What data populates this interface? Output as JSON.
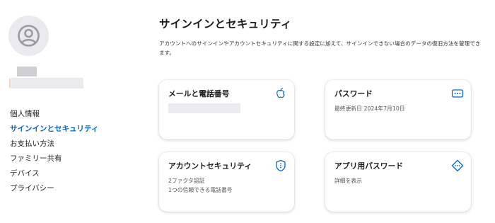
{
  "sidebar": {
    "nav": [
      {
        "label": "個人情報"
      },
      {
        "label": "サインインとセキュリティ"
      },
      {
        "label": "お支払い方法"
      },
      {
        "label": "ファミリー共有"
      },
      {
        "label": "デバイス"
      },
      {
        "label": "プライバシー"
      }
    ],
    "active_index": 1
  },
  "main": {
    "title": "サインインとセキュリティ",
    "description": "アカウントへのサインインやアカウントセキュリティに関する設定に加えて、サインインできない場合のデータの復旧方法を管理できます。",
    "cards": [
      {
        "title": "メールと電話番号",
        "icon": "apple-icon"
      },
      {
        "title": "パスワード",
        "subtitle": "最終更新日 2024年7月10日",
        "icon": "password-dots-icon"
      },
      {
        "title": "アカウントセキュリティ",
        "lines": [
          "2ファクタ認証",
          "1つの信頼できる電話番号"
        ],
        "icon": "shield-icon"
      },
      {
        "title": "アプリ用パスワード",
        "subtitle": "詳細を表示",
        "icon": "key-diamond-icon"
      }
    ]
  },
  "colors": {
    "accent": "#0066cc",
    "text": "#1d1d1f",
    "avatar_bg": "#e9e9ee"
  }
}
